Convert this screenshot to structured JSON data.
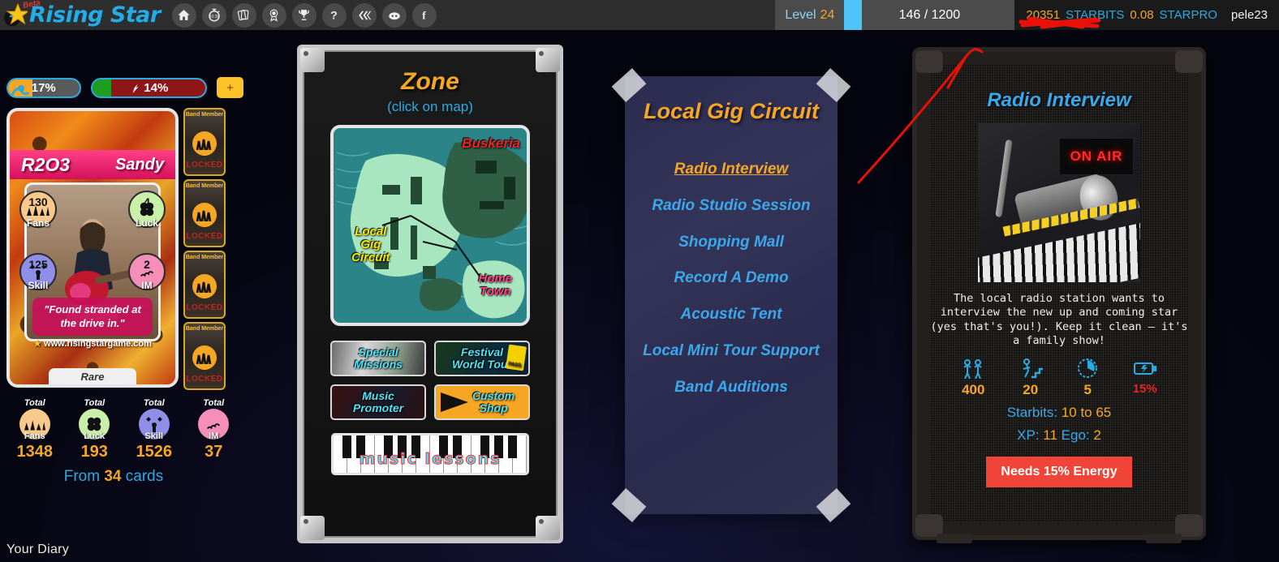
{
  "header": {
    "logo_text": "Rising Star",
    "beta_label": "Beta",
    "nav_icons": [
      {
        "name": "home-icon",
        "glyph": "⌂"
      },
      {
        "name": "timer-icon",
        "glyph": "⏱"
      },
      {
        "name": "cards-icon",
        "glyph": "Ἂ0"
      },
      {
        "name": "medal-icon",
        "glyph": "★"
      },
      {
        "name": "trophy-icon",
        "glyph": "Ἴ6"
      },
      {
        "name": "help-icon",
        "glyph": "?"
      },
      {
        "name": "hive-icon",
        "glyph": "»"
      },
      {
        "name": "discord-icon",
        "glyph": "●"
      },
      {
        "name": "facebook-icon",
        "glyph": "f"
      }
    ]
  },
  "status": {
    "level_label": "Level",
    "level_value": "24",
    "xp_text": "146 / 1200",
    "xp_percent": 12,
    "starbits_value": "20351",
    "starbits_label": "STARBITS",
    "starpro_value": "0.08",
    "starpro_label": "STARPRO",
    "username": "pele23"
  },
  "left": {
    "bar_fame": {
      "value": "17%",
      "percent": 17
    },
    "bar_energy": {
      "value": "14%",
      "percent": 14
    },
    "plus_label": "+",
    "card": {
      "id": "R2O3",
      "name": "Sandy",
      "quote": "\"Found stranded at the drive in.\"",
      "rarity": "Rare",
      "url": "www.risingstargame.com",
      "stats": [
        {
          "label": "Fans",
          "value": "130"
        },
        {
          "label": "Luck",
          "value": "4"
        },
        {
          "label": "Skill",
          "value": "125"
        },
        {
          "label": "IM",
          "value": "2"
        }
      ]
    },
    "band_slots": [
      {
        "title": "Band Member",
        "state": "LOCKED"
      },
      {
        "title": "Band Member",
        "state": "LOCKED"
      },
      {
        "title": "Band Member",
        "state": "LOCKED"
      },
      {
        "title": "Band Member",
        "state": "LOCKED"
      }
    ],
    "totals_caption": "Total",
    "totals": [
      {
        "label": "Fans",
        "value": "1348"
      },
      {
        "label": "Luck",
        "value": "193"
      },
      {
        "label": "Skill",
        "value": "1526"
      },
      {
        "label": "IM",
        "value": "37"
      }
    ],
    "from_cards_prefix": "From ",
    "from_cards_count": "34",
    "from_cards_suffix": " cards",
    "diary_label": "Your Diary"
  },
  "zone": {
    "title": "Zone",
    "subtitle": "(click on map)",
    "map_labels": {
      "buskeria": "Buskeria",
      "local_gig_circuit": "Local\nGig\nCircuit",
      "home_town": "Home\nTown"
    },
    "buttons": [
      {
        "label": "Special\nMissions",
        "name": "special-missions-button"
      },
      {
        "label": "Festival\nWorld Tour",
        "name": "festival-world-tour-button"
      },
      {
        "label": "Music\nPromoter",
        "name": "music-promoter-button"
      },
      {
        "label": "Custom\nShop",
        "name": "custom-shop-button"
      }
    ],
    "pass_badge": "PASS",
    "piano_text": "music lessons"
  },
  "gig_panel": {
    "title": "Local Gig Circuit",
    "items": [
      {
        "label": "Radio Interview",
        "active": true
      },
      {
        "label": "Radio Studio Session",
        "active": false
      },
      {
        "label": "Shopping Mall",
        "active": false
      },
      {
        "label": "Record A Demo",
        "active": false
      },
      {
        "label": "Acoustic Tent",
        "active": false
      },
      {
        "label": "Local Mini Tour Support",
        "active": false
      },
      {
        "label": "Band Auditions",
        "active": false
      }
    ]
  },
  "amp_panel": {
    "title": "Radio Interview",
    "on_air": "ON AIR",
    "description": "The local radio station wants to interview the new up and coming star (yes that's you!). Keep it clean – it's a family show!",
    "stat_icons": [
      {
        "name": "fans-icon"
      },
      {
        "name": "skill-icon"
      },
      {
        "name": "time-icon"
      },
      {
        "name": "energy-icon"
      }
    ],
    "stat_values": [
      "400",
      "20",
      "5",
      "15%"
    ],
    "starbits_line": "Starbits: 10 to 65",
    "starbits_label": "Starbits:",
    "starbits_range": "10 to 65",
    "xp_label": "XP:",
    "xp_value": "11",
    "ego_label": "Ego:",
    "ego_value": "2",
    "button_label": "Needs 15% Energy"
  },
  "colors": {
    "accent_orange": "#f5a623",
    "accent_cyan": "#29abe2",
    "danger_red": "#f04438",
    "annotation_red": "#e8110a"
  }
}
